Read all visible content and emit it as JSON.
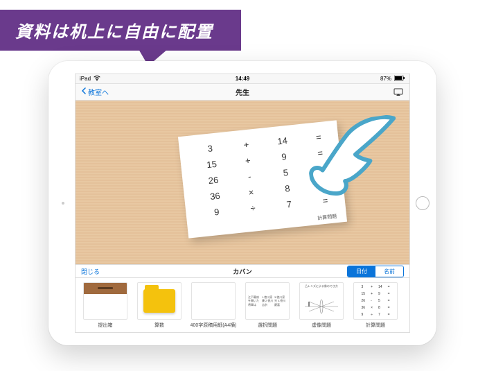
{
  "caption": "資料は机上に自由に配置",
  "statusbar": {
    "carrier": "iPad",
    "wifi_icon": "wifi",
    "time": "14:49",
    "battery": "87%"
  },
  "navbar": {
    "back_label": "教室へ",
    "title": "先生"
  },
  "sheet": {
    "rows": [
      [
        "3",
        "+",
        "14",
        "="
      ],
      [
        "15",
        "+",
        "9",
        "="
      ],
      [
        "26",
        "-",
        "5",
        "="
      ],
      [
        "36",
        "×",
        "8",
        "="
      ],
      [
        "9",
        "÷",
        "7",
        "="
      ]
    ],
    "label": "計算問題"
  },
  "bagbar": {
    "close": "閉じる",
    "title": "カバン",
    "seg_date": "日付",
    "seg_name": "名前"
  },
  "shelf": [
    {
      "kind": "drawer",
      "label": "提出箱"
    },
    {
      "kind": "folder",
      "label": "算数"
    },
    {
      "kind": "grid",
      "label": "400字原稿用紙(A4横)"
    },
    {
      "kind": "text",
      "label": "選択問題",
      "lines": [
        "江戸幕府を開いた将軍は",
        "1.徳川家康  2.徳川吉宗",
        "3.徳川家光  4.徳川慶喜"
      ]
    },
    {
      "kind": "graph",
      "label": "虚像問題",
      "lines": [
        "凸レンズによる像のでき方"
      ]
    },
    {
      "kind": "calc",
      "label": "計算問題"
    }
  ]
}
